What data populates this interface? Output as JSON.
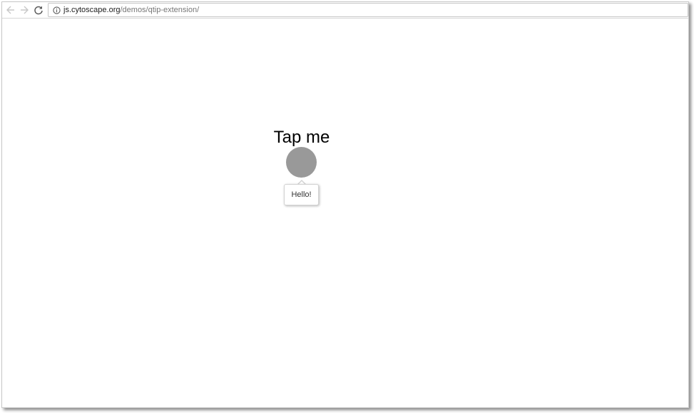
{
  "browser": {
    "back_icon": "arrow-left-icon",
    "forward_icon": "arrow-right-icon",
    "reload_icon": "reload-icon",
    "info_icon": "info-icon",
    "url_host": "js.cytoscape.org",
    "url_path": "/demos/qtip-extension/"
  },
  "graph": {
    "node_label": "Tap me",
    "node_color": "#999999",
    "tooltip_text": "Hello!"
  }
}
